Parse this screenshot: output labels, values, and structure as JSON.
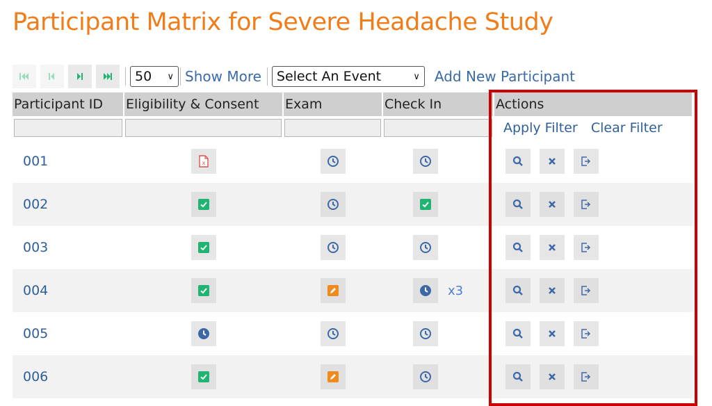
{
  "page": {
    "title": "Participant Matrix for Severe Headache Study"
  },
  "toolbar": {
    "first_icon": "first-page-icon",
    "prev_icon": "previous-page-icon",
    "next_icon": "next-page-icon",
    "last_icon": "last-page-icon",
    "page_size": "50",
    "show_more": "Show More",
    "event_select": "Select An Event",
    "add_participant": "Add New Participant"
  },
  "table": {
    "headers": [
      "Participant ID",
      "Eligibility & Consent",
      "Exam",
      "Check In",
      "Actions"
    ],
    "apply_filter": "Apply Filter",
    "clear_filter": "Clear Filter",
    "rows": [
      {
        "id": "001",
        "eligibility": "pdf-error",
        "exam": "clock",
        "checkin": "clock",
        "count": ""
      },
      {
        "id": "002",
        "eligibility": "check",
        "exam": "clock",
        "checkin": "check",
        "count": ""
      },
      {
        "id": "003",
        "eligibility": "check",
        "exam": "clock",
        "checkin": "clock",
        "count": ""
      },
      {
        "id": "004",
        "eligibility": "check",
        "exam": "edit",
        "checkin": "clock-filled",
        "count": "x3"
      },
      {
        "id": "005",
        "eligibility": "clock-filled",
        "exam": "clock",
        "checkin": "clock",
        "count": ""
      },
      {
        "id": "006",
        "eligibility": "check",
        "exam": "edit",
        "checkin": "clock",
        "count": ""
      }
    ],
    "actions": [
      "search-icon",
      "remove-icon",
      "sign-out-icon"
    ]
  },
  "colors": {
    "title": "#f07d1a",
    "link": "#2f5f9a",
    "check": "#1fb471",
    "edit": "#f08a1c",
    "clock": "#3d68a8",
    "pdf": "#d9534f",
    "highlight": "#cc0000",
    "header_bg": "#cfcfcf"
  }
}
